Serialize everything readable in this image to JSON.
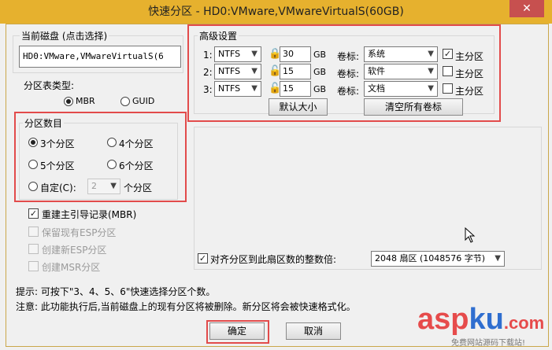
{
  "window": {
    "title": "快速分区 - HD0:VMware,VMwareVirtualS(60GB)",
    "close_glyph": "✕"
  },
  "current_disk": {
    "title": "当前磁盘 (点击选择)",
    "value": "HD0:VMware,VMwareVirtualS(6"
  },
  "partition_table": {
    "title": "分区表类型:",
    "options": [
      "MBR",
      "GUID"
    ]
  },
  "partition_count": {
    "title": "分区数目",
    "options": [
      "3个分区",
      "4个分区",
      "5个分区",
      "6个分区",
      "自定(C):"
    ],
    "custom_value": "2",
    "custom_suffix": "个分区"
  },
  "checkboxes": {
    "rebuild_mbr": "重建主引导记录(MBR)",
    "keep_esp": "保留现有ESP分区",
    "create_esp": "创建新ESP分区",
    "create_msr": "创建MSR分区"
  },
  "advanced": {
    "title": "高级设置",
    "unit": "GB",
    "label_title": "卷标:",
    "primary_label": "主分区",
    "rows": [
      {
        "index": "1:",
        "fs": "NTFS",
        "size": "30",
        "label": "系统"
      },
      {
        "index": "2:",
        "fs": "NTFS",
        "size": "15",
        "label": "软件"
      },
      {
        "index": "3:",
        "fs": "NTFS",
        "size": "15",
        "label": "文档"
      }
    ],
    "default_size_button": "默认大小",
    "clear_labels_button": "清空所有卷标"
  },
  "align": {
    "label": "对齐分区到此扇区数的整数倍:",
    "value": "2048 扇区 (1048576 字节)"
  },
  "hints": {
    "hint": "提示: 可按下\"3、4、5、6\"快速选择分区个数。",
    "note": "注意: 此功能执行后,当前磁盘上的现有分区将被删除。新分区将会被快速格式化。"
  },
  "buttons": {
    "ok": "确定",
    "cancel": "取消"
  },
  "watermark": {
    "asp": "asp",
    "ku": "ku",
    "tld": ".com",
    "sub": "免费网站源码下载站!"
  },
  "colors": {
    "title_bar": "#e6b12e",
    "close_button": "#c7504f",
    "highlight": "#e24b4b"
  }
}
